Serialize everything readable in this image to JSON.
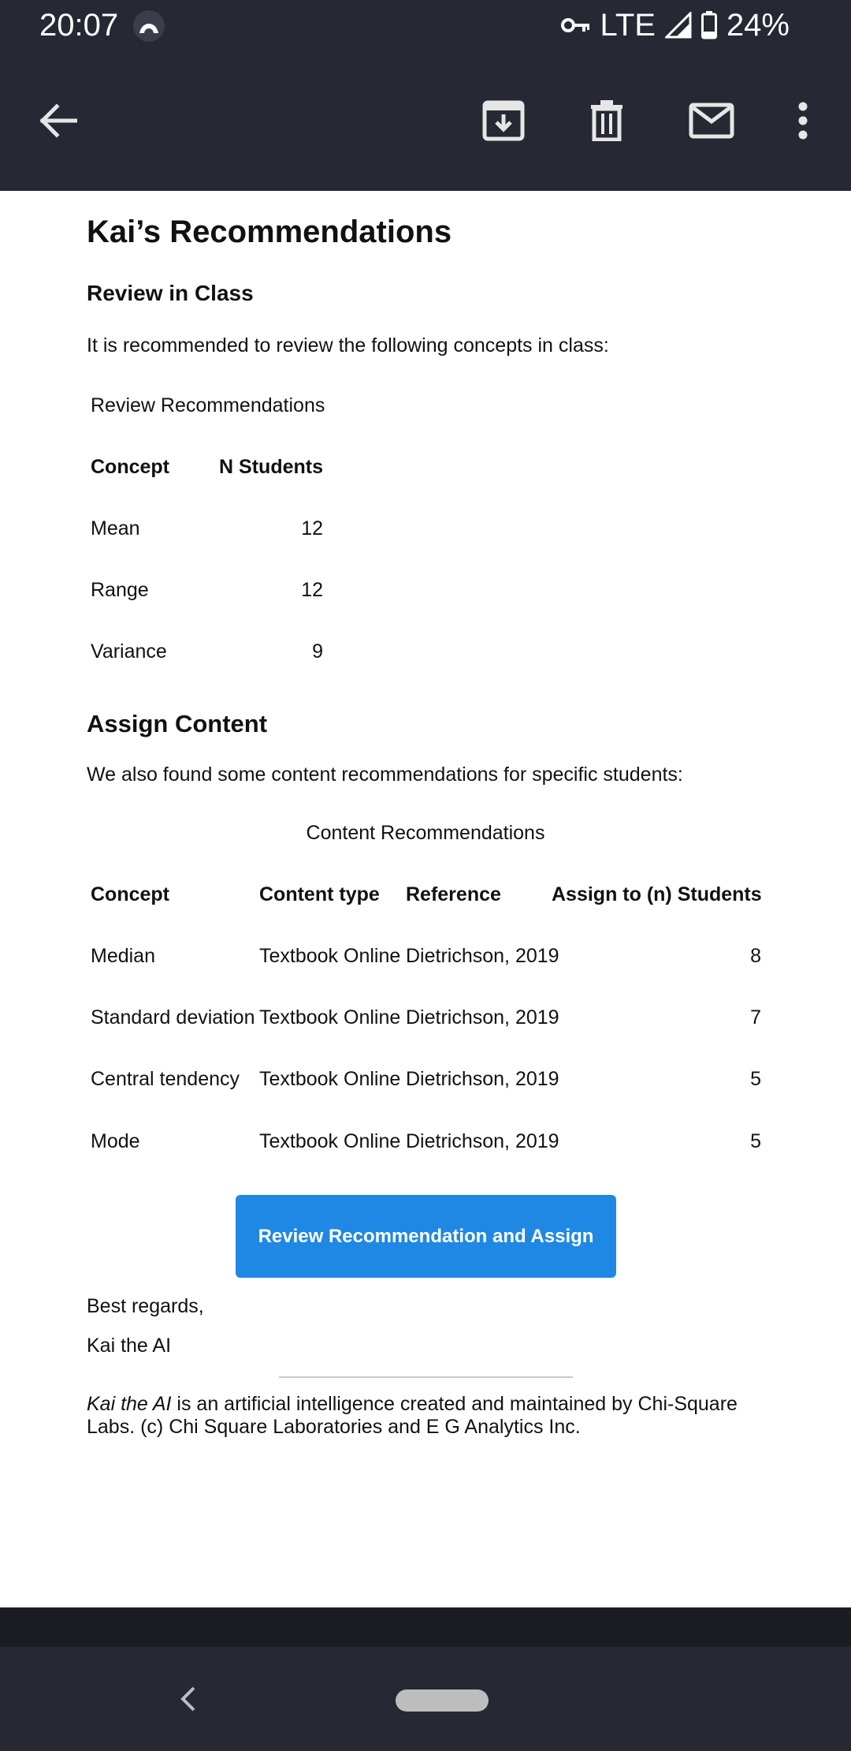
{
  "status_bar": {
    "time": "20:07",
    "network": "LTE",
    "battery": "24%"
  },
  "app_bar": {
    "icons": [
      "back-arrow-icon",
      "archive-icon",
      "delete-icon",
      "mail-icon",
      "more-vert-icon"
    ]
  },
  "email": {
    "title": "Kai’s Recommendations",
    "review_heading": "Review in Class",
    "review_intro": "It is recommended to review the following concepts in class:",
    "review_table": {
      "caption": "Review Recommendations",
      "headers": [
        "Concept",
        "N Students"
      ],
      "rows": [
        {
          "concept": "Mean",
          "n": "12"
        },
        {
          "concept": "Range",
          "n": "12"
        },
        {
          "concept": "Variance",
          "n": "9"
        }
      ]
    },
    "assign_heading": "Assign Content",
    "assign_intro": "We also found some content recommendations for specific students:",
    "content_table": {
      "caption": "Content Recommendations",
      "headers": [
        "Concept",
        "Content type",
        "Reference",
        "Assign to (n) Students"
      ],
      "rows": [
        {
          "concept": "Median",
          "type": "Textbook Online",
          "reference": "Dietrichson, 2019",
          "n": "8"
        },
        {
          "concept": "Standard deviation",
          "type": "Textbook Online",
          "reference": "Dietrichson, 2019",
          "n": "7"
        },
        {
          "concept": "Central tendency",
          "type": "Textbook Online",
          "reference": "Dietrichson, 2019",
          "n": "5"
        },
        {
          "concept": "Mode",
          "type": "Textbook Online",
          "reference": "Dietrichson, 2019",
          "n": "5"
        }
      ]
    },
    "cta_label": "Review Recommendation and Assign",
    "closing": "Best regards,",
    "signature": "Kai the AI",
    "footer_emph": "Kai the AI",
    "footer_rest": " is an artificial intelligence created and maintained by Chi-Square Labs. (c) Chi Square Laboratories and E G Analytics Inc."
  },
  "colors": {
    "chrome": "#262833",
    "accent": "#1f88e4"
  }
}
